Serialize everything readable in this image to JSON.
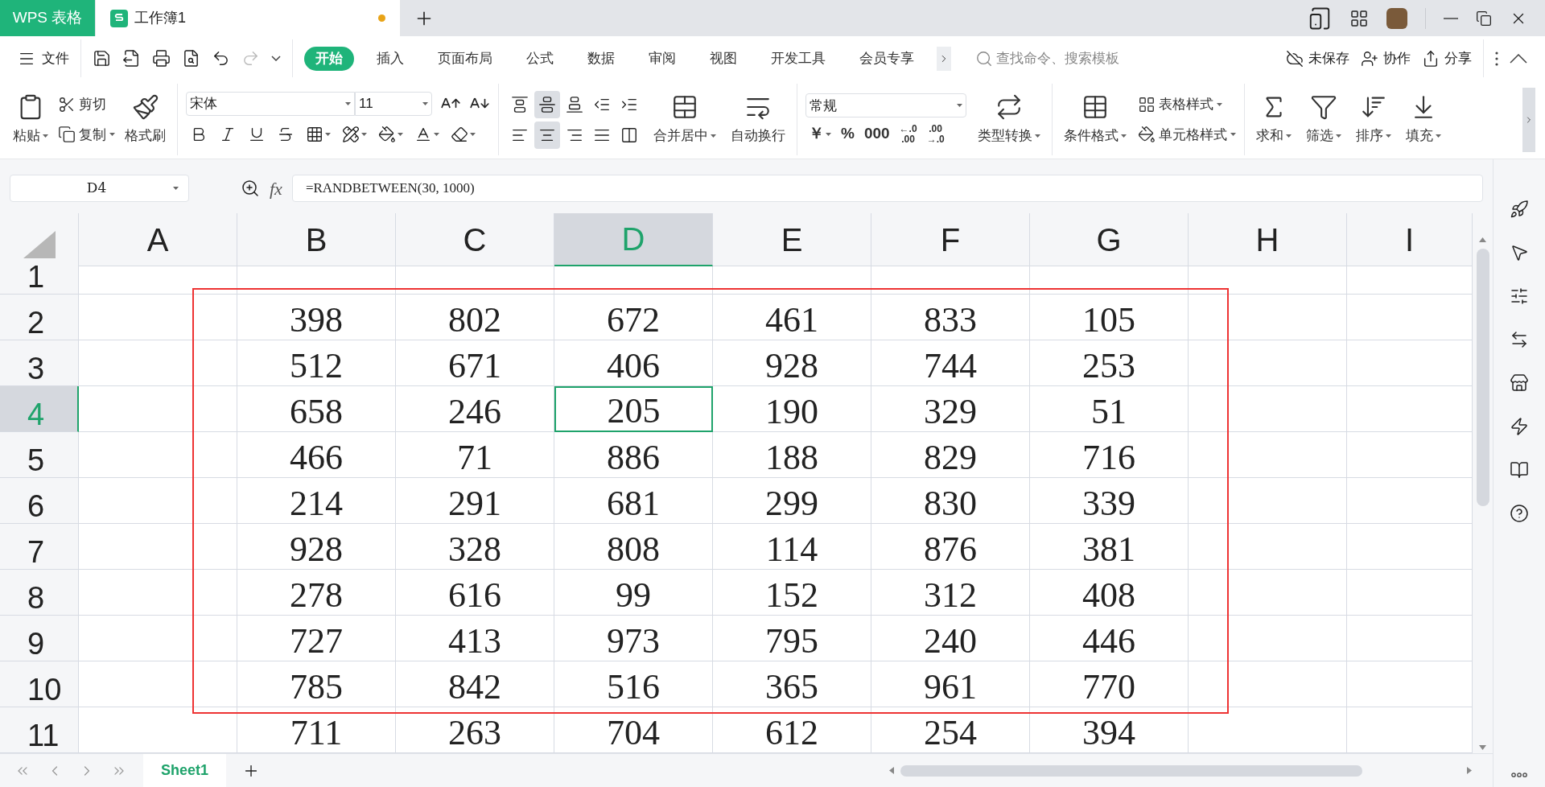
{
  "title_bar": {
    "app_tab": "WPS 表格",
    "document_tab": {
      "title": "工作簿1",
      "unsaved": true
    }
  },
  "menu": {
    "file": "文件",
    "tabs": [
      {
        "label": "开始",
        "selected": true
      },
      {
        "label": "插入",
        "selected": false
      },
      {
        "label": "页面布局",
        "selected": false
      },
      {
        "label": "公式",
        "selected": false
      },
      {
        "label": "数据",
        "selected": false
      },
      {
        "label": "审阅",
        "selected": false
      },
      {
        "label": "视图",
        "selected": false
      },
      {
        "label": "开发工具",
        "selected": false
      },
      {
        "label": "会员专享",
        "selected": false
      }
    ],
    "search": {
      "placeholder": "查找命令、搜索模板"
    },
    "actions": [
      "未保存",
      "协作",
      "分享"
    ]
  },
  "ribbon": {
    "clipboard": {
      "paste": "粘贴",
      "cut": "剪切",
      "copy": "复制",
      "format_painter": "格式刷"
    },
    "font": {
      "name": "宋体",
      "size": "11"
    },
    "alignment": {
      "vertical": [
        {
          "selected": false
        },
        {
          "selected": true
        },
        {
          "selected": false
        }
      ],
      "horizontal": [
        {
          "selected": false
        },
        {
          "selected": true
        },
        {
          "selected": false
        },
        {
          "selected": false
        }
      ],
      "merge": "合并居中",
      "wrap": "自动换行"
    },
    "number": {
      "format": "常规",
      "symbols": [
        "￥",
        "%",
        "000"
      ],
      "decimals": [
        {
          "top": "←.0",
          "bottom": ".00"
        },
        {
          "top": ".00",
          "bottom": "→.0"
        }
      ],
      "convert": "类型转换"
    },
    "styles": {
      "conditional": "条件格式",
      "table_style": "表格样式",
      "cell_style": "单元格样式"
    },
    "editing": [
      "求和",
      "筛选",
      "排序",
      "填充"
    ]
  },
  "formula_bar": {
    "name_box": "D4",
    "fx": "fx",
    "formula": "=RANDBETWEEN(30, 1000)"
  },
  "grid": {
    "columns": [
      {
        "label": "A",
        "selected": false
      },
      {
        "label": "B",
        "selected": false
      },
      {
        "label": "C",
        "selected": false
      },
      {
        "label": "D",
        "selected": true
      },
      {
        "label": "E",
        "selected": false
      },
      {
        "label": "F",
        "selected": false
      },
      {
        "label": "G",
        "selected": false
      },
      {
        "label": "H",
        "selected": false
      },
      {
        "label": "I",
        "selected": false
      }
    ],
    "rows": [
      {
        "label": "1",
        "selected": false
      },
      {
        "label": "2",
        "selected": false,
        "cells": [
          {
            "value": "398",
            "selected": false
          },
          {
            "value": "802",
            "selected": false
          },
          {
            "value": "672",
            "selected": false
          },
          {
            "value": "461",
            "selected": false
          },
          {
            "value": "833",
            "selected": false
          },
          {
            "value": "105",
            "selected": false
          }
        ]
      },
      {
        "label": "3",
        "selected": false,
        "cells": [
          {
            "value": "512",
            "selected": false
          },
          {
            "value": "671",
            "selected": false
          },
          {
            "value": "406",
            "selected": false
          },
          {
            "value": "928",
            "selected": false
          },
          {
            "value": "744",
            "selected": false
          },
          {
            "value": "253",
            "selected": false
          }
        ]
      },
      {
        "label": "4",
        "selected": true,
        "cells": [
          {
            "value": "658",
            "selected": false
          },
          {
            "value": "246",
            "selected": false
          },
          {
            "value": "205",
            "selected": true
          },
          {
            "value": "190",
            "selected": false
          },
          {
            "value": "329",
            "selected": false
          },
          {
            "value": "51",
            "selected": false
          }
        ]
      },
      {
        "label": "5",
        "selected": false,
        "cells": [
          {
            "value": "466",
            "selected": false
          },
          {
            "value": "71",
            "selected": false
          },
          {
            "value": "886",
            "selected": false
          },
          {
            "value": "188",
            "selected": false
          },
          {
            "value": "829",
            "selected": false
          },
          {
            "value": "716",
            "selected": false
          }
        ]
      },
      {
        "label": "6",
        "selected": false,
        "cells": [
          {
            "value": "214",
            "selected": false
          },
          {
            "value": "291",
            "selected": false
          },
          {
            "value": "681",
            "selected": false
          },
          {
            "value": "299",
            "selected": false
          },
          {
            "value": "830",
            "selected": false
          },
          {
            "value": "339",
            "selected": false
          }
        ]
      },
      {
        "label": "7",
        "selected": false,
        "cells": [
          {
            "value": "928",
            "selected": false
          },
          {
            "value": "328",
            "selected": false
          },
          {
            "value": "808",
            "selected": false
          },
          {
            "value": "114",
            "selected": false
          },
          {
            "value": "876",
            "selected": false
          },
          {
            "value": "381",
            "selected": false
          }
        ]
      },
      {
        "label": "8",
        "selected": false,
        "cells": [
          {
            "value": "278",
            "selected": false
          },
          {
            "value": "616",
            "selected": false
          },
          {
            "value": "99",
            "selected": false
          },
          {
            "value": "152",
            "selected": false
          },
          {
            "value": "312",
            "selected": false
          },
          {
            "value": "408",
            "selected": false
          }
        ]
      },
      {
        "label": "9",
        "selected": false,
        "cells": [
          {
            "value": "727",
            "selected": false
          },
          {
            "value": "413",
            "selected": false
          },
          {
            "value": "973",
            "selected": false
          },
          {
            "value": "795",
            "selected": false
          },
          {
            "value": "240",
            "selected": false
          },
          {
            "value": "446",
            "selected": false
          }
        ]
      },
      {
        "label": "10",
        "selected": false,
        "cells": [
          {
            "value": "785",
            "selected": false
          },
          {
            "value": "842",
            "selected": false
          },
          {
            "value": "516",
            "selected": false
          },
          {
            "value": "365",
            "selected": false
          },
          {
            "value": "961",
            "selected": false
          },
          {
            "value": "770",
            "selected": false
          }
        ]
      },
      {
        "label": "11",
        "selected": false,
        "cells": [
          {
            "value": "711",
            "selected": false
          },
          {
            "value": "263",
            "selected": false
          },
          {
            "value": "704",
            "selected": false
          },
          {
            "value": "612",
            "selected": false
          },
          {
            "value": "254",
            "selected": false
          },
          {
            "value": "394",
            "selected": false
          }
        ]
      }
    ]
  },
  "sheet_tabs": [
    {
      "label": "Sheet1",
      "selected": true
    }
  ]
}
